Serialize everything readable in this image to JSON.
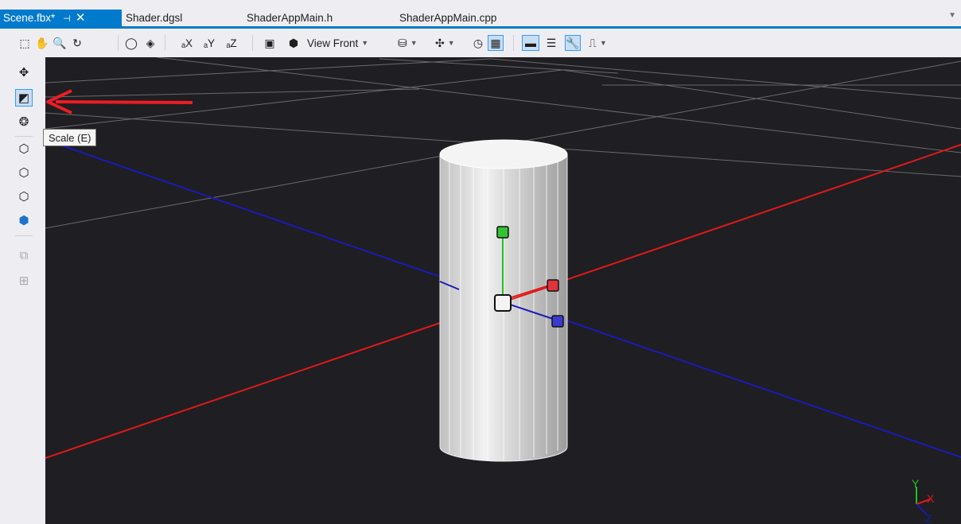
{
  "tabs": [
    {
      "label": "Scene.fbx*",
      "active": true
    },
    {
      "label": "Shader.dgsl",
      "active": false
    },
    {
      "label": "ShaderAppMain.h",
      "active": false
    },
    {
      "label": "ShaderAppMain.cpp",
      "active": false
    }
  ],
  "toolbar": {
    "view_label": "View Front",
    "icons": [
      "marquee-select-icon",
      "pan-hand-icon",
      "zoom-icon",
      "orbit-icon",
      "frame-all-icon",
      "frame-selected-icon",
      "flip-x-icon",
      "flip-y-icon",
      "flip-z-icon",
      "render-options-icon",
      "shading-mode-icon",
      "view-front-dropdown",
      "geometry-icon",
      "material-icon",
      "pivot-icon",
      "grid-toggle-icon",
      "toolbox-icon",
      "document-outline-icon",
      "properties-icon",
      "advanced-icon"
    ]
  },
  "left_tools": [
    "translate-icon",
    "scale-icon",
    "rotate-icon",
    "select-object-icon",
    "select-face-icon",
    "select-edge-icon",
    "select-vertex-icon",
    "duplicate-icon",
    "group-icon"
  ],
  "tooltip": {
    "text": "Scale (E)"
  },
  "axis_indicator": {
    "y": "Y",
    "x": "X",
    "z": "Z"
  },
  "colors": {
    "accent": "#007acc",
    "x_axis": "#e0191c",
    "z_axis": "#1a1ab8",
    "y_axis": "#22c022",
    "viewport_bg": "#1f1e22",
    "annotation_arrow": "#ee1c24"
  }
}
